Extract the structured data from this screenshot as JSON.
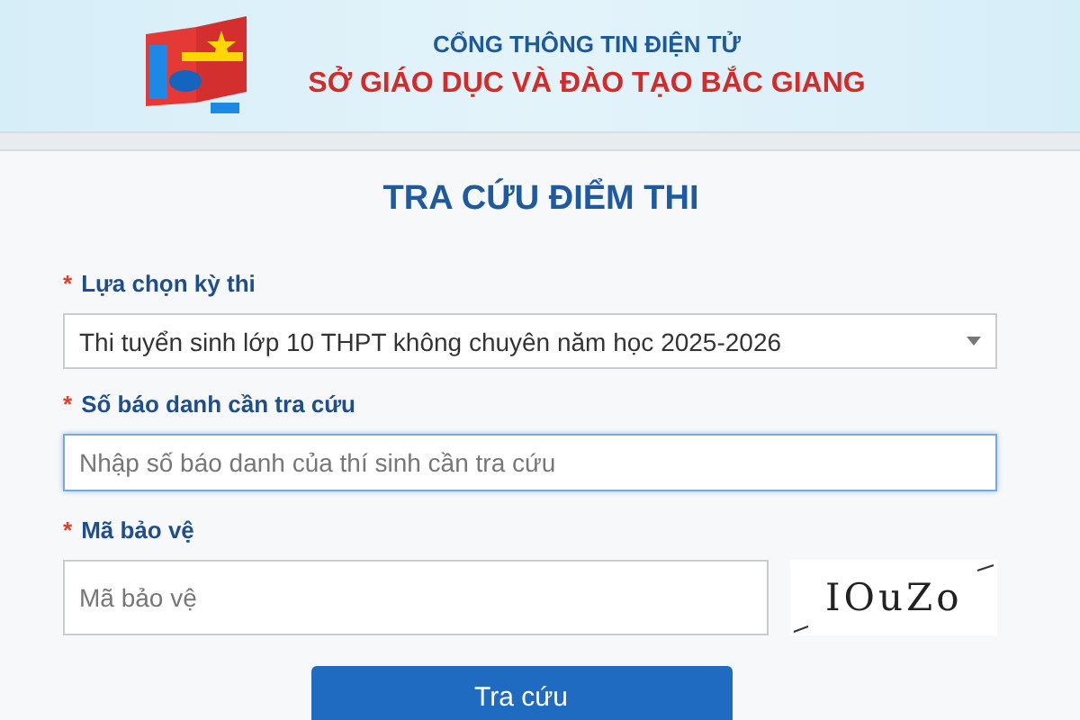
{
  "header": {
    "portal_title": "CỔNG THÔNG TIN ĐIỆN TỬ",
    "department": "SỞ GIÁO DỤC VÀ ĐÀO TẠO BẮC GIANG"
  },
  "form": {
    "title": "TRA CỨU ĐIỂM THI",
    "fields": [
      {
        "kind": "select",
        "label": "Lựa chọn kỳ thi",
        "required_mark": "*",
        "value": "Thi tuyển sinh lớp 10 THPT không chuyên năm học 2025-2026"
      },
      {
        "kind": "text",
        "label": "Số báo danh cần tra cứu",
        "required_mark": "*",
        "placeholder": "Nhập số báo danh của thí sinh cần tra cứu",
        "focused": true
      },
      {
        "kind": "captcha",
        "label": "Mã bảo vệ",
        "required_mark": "*",
        "placeholder": "Mã bảo vệ",
        "captcha": "IOuZo"
      }
    ],
    "submit": "Tra cứu"
  }
}
